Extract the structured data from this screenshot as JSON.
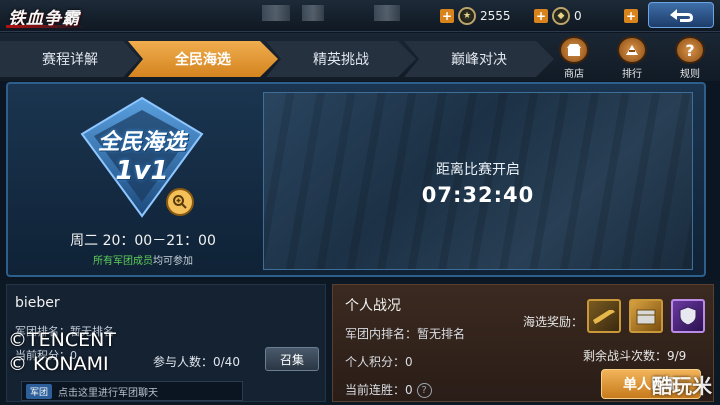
{
  "header": {
    "title": "铁血争霸",
    "currency_1": {
      "icon": "medal-coin-icon",
      "value": "2555"
    },
    "currency_2": {
      "icon": "shield-coin-icon",
      "value": "0"
    },
    "back_icon": "return-arrow-icon"
  },
  "tabs": [
    {
      "label": "赛程详解",
      "active": false
    },
    {
      "label": "全民海选",
      "active": true
    },
    {
      "label": "精英挑战",
      "active": false
    },
    {
      "label": "巅峰对决",
      "active": false
    }
  ],
  "side_buttons": [
    {
      "label": "商店",
      "icon": "shop-icon"
    },
    {
      "label": "排行",
      "icon": "ranking-icon"
    },
    {
      "label": "规则",
      "icon": "rules-icon"
    }
  ],
  "event": {
    "badge_title": "全民海选",
    "badge_mode": "1v1",
    "schedule": "周二 20：00－21：00",
    "eligibility_green": "所有军团成员",
    "eligibility_rest": "均可参加"
  },
  "countdown": {
    "label": "距离比赛开启",
    "time": "07:32:40"
  },
  "player": {
    "name": "bieber",
    "rank_line": "军团排名：暂无排名",
    "score_line": "当前积分：0",
    "participants": "参与人数：0/40",
    "summon_label": "召集",
    "chat_tag": "军团",
    "chat_placeholder": "点击这里进行军团聊天"
  },
  "watermark": {
    "line1": "©TENCENT",
    "line2": "© KONAMI"
  },
  "personal": {
    "title": "个人战况",
    "rank": "军团内排名：暂无排名",
    "score": "个人积分：0",
    "streak": "当前连胜：0",
    "reward_label": "海选奖励：",
    "rewards": [
      "golden-rifle-icon",
      "crate-icon",
      "shield-badge-icon"
    ],
    "remaining": "剩余战斗次数：9/9",
    "single_button": "单人匹配"
  },
  "site_mark": "酷玩米",
  "colors": {
    "active_tab": "#f0ad4e",
    "accent_blue": "#2c5f8c",
    "green": "#5fcf5a"
  }
}
